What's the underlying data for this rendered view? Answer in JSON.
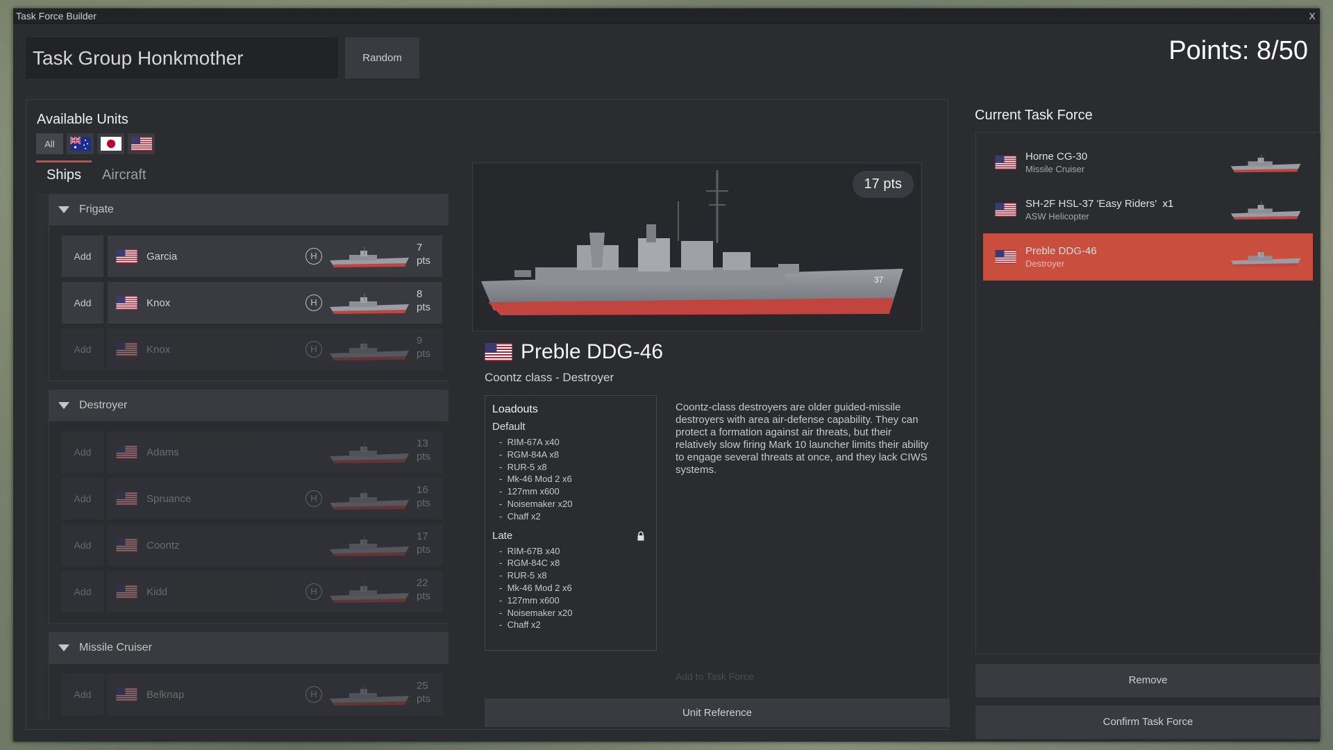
{
  "window": {
    "title": "Task Force Builder",
    "close_label": "X"
  },
  "header": {
    "group_name": "Task Group Honkmother",
    "random_label": "Random",
    "points_label": "Points: 8/50"
  },
  "available": {
    "title": "Available Units",
    "filters": [
      {
        "label": "All",
        "icon": "all"
      },
      {
        "icon": "australia-flag-icon"
      },
      {
        "icon": "japan-flag-icon"
      },
      {
        "icon": "usa-flag-icon"
      }
    ],
    "tabs": [
      "Ships",
      "Aircraft"
    ],
    "groups": [
      {
        "name": "Frigate",
        "units": [
          {
            "add": "Add",
            "name": "Garcia",
            "helo": "H",
            "pts": "7",
            "pts_unit": "pts",
            "enabled": true
          },
          {
            "add": "Add",
            "name": "Knox",
            "helo": "H",
            "pts": "8",
            "pts_unit": "pts",
            "enabled": true
          },
          {
            "add": "Add",
            "name": "Knox",
            "helo": "H",
            "pts": "9",
            "pts_unit": "pts",
            "enabled": false
          }
        ]
      },
      {
        "name": "Destroyer",
        "units": [
          {
            "add": "Add",
            "name": "Adams",
            "helo": "",
            "pts": "13",
            "pts_unit": "pts",
            "enabled": false
          },
          {
            "add": "Add",
            "name": "Spruance",
            "helo": "H",
            "pts": "16",
            "pts_unit": "pts",
            "enabled": false
          },
          {
            "add": "Add",
            "name": "Coontz",
            "helo": "",
            "pts": "17",
            "pts_unit": "pts",
            "enabled": false
          },
          {
            "add": "Add",
            "name": "Kidd",
            "helo": "H",
            "pts": "22",
            "pts_unit": "pts",
            "enabled": false
          }
        ]
      },
      {
        "name": "Missile Cruiser",
        "units": [
          {
            "add": "Add",
            "name": "Belknap",
            "helo": "H",
            "pts": "25",
            "pts_unit": "pts",
            "enabled": false
          }
        ]
      }
    ]
  },
  "detail": {
    "pts_badge": "17 pts",
    "name": "Preble DDG-46",
    "class_line": "Coontz class - Destroyer",
    "loadouts_title": "Loadouts",
    "default_title": "Default",
    "default_items": [
      "RIM-67A x40",
      "RGM-84A x8",
      "RUR-5 x8",
      "Mk-46 Mod 2 x6",
      "127mm x600",
      "Noisemaker x20",
      "Chaff x2"
    ],
    "late_title": "Late",
    "late_items": [
      "RIM-67B x40",
      "RGM-84C x8",
      "RUR-5 x8",
      "Mk-46 Mod 2 x6",
      "127mm x600",
      "Noisemaker x20",
      "Chaff x2"
    ],
    "description": "Coontz-class destroyers are older guided-missile destroyers with area air-defense capability. They can protect a formation against air threats, but their relatively slow firing Mark 10 launcher limits their ability to engage several threats at once, and they lack CIWS systems.",
    "add_to_task_force": "Add to Task Force",
    "unit_reference": "Unit Reference",
    "hull_number": "37"
  },
  "current": {
    "title": "Current Task Force",
    "items": [
      {
        "name": "Horne CG-30",
        "type": "Missile Cruiser",
        "selected": false
      },
      {
        "name": "SH-2F HSL-37 'Easy Riders'",
        "count": "x1",
        "type": "ASW Helicopter",
        "selected": false
      },
      {
        "name": "Preble DDG-46",
        "type": "Destroyer",
        "selected": true
      }
    ],
    "remove_label": "Remove",
    "confirm_label": "Confirm Task Force"
  },
  "colors": {
    "accent": "#c94e3e",
    "panel": "#2b2c30",
    "button": "#3a3b40"
  }
}
